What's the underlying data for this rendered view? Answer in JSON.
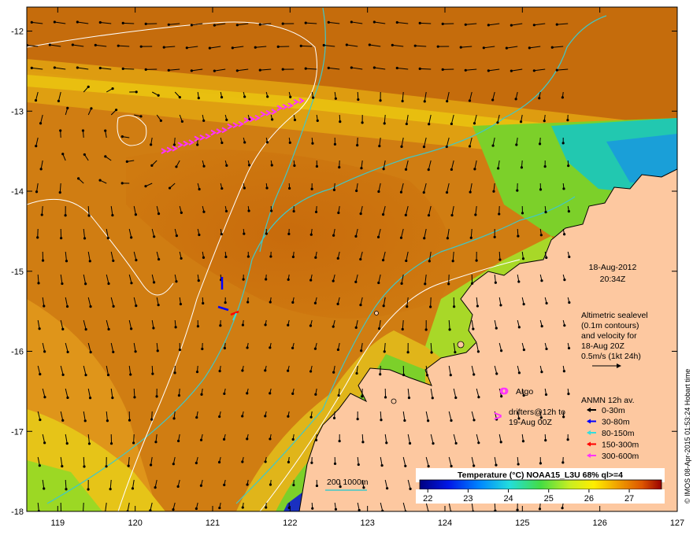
{
  "map": {
    "date_line1": "18-Aug-2012",
    "date_line2": "20:34Z",
    "altimetry_lines": [
      "Altimetric sealevel",
      "(0.1m contours)",
      "and velocity for",
      "18-Aug 20Z",
      "0.5m/s (1kt 24h)"
    ],
    "argo_label": "Argo",
    "drifters_line1": "drifters@12h to",
    "drifters_line2": "19-Aug 00Z",
    "anmn_title": "ANMN 12h av.",
    "anmn_legend": [
      {
        "label": "0-30m",
        "color": "#000000"
      },
      {
        "label": "30-80m",
        "color": "#0000ff"
      },
      {
        "label": "80-150m",
        "color": "#33dddd"
      },
      {
        "label": "150-300m",
        "color": "#ff0000"
      },
      {
        "label": "300-600m",
        "color": "#ff33ff"
      }
    ],
    "bathymetry_label": "200  1000m",
    "credit": "© IMOS 08-Apr-2015 01:53:24 Hobart time"
  },
  "colorbar": {
    "title": "Temperature (°C) NOAA15_L3U 68% ql>=4",
    "ticks": [
      "22",
      "23",
      "24",
      "25",
      "26",
      "27"
    ],
    "range": [
      21.8,
      27.8
    ]
  },
  "axes": {
    "x_ticks": [
      "119",
      "120",
      "121",
      "122",
      "123",
      "124",
      "125",
      "126",
      "127"
    ],
    "y_ticks": [
      "-12",
      "-13",
      "-14",
      "-15",
      "-16",
      "-17",
      "-18"
    ],
    "x_range": [
      118.6,
      127
    ],
    "y_range": [
      -18,
      -11.7
    ]
  },
  "colors": {
    "land": "#fdc8a0",
    "warm_water": "#d2780f",
    "cool_water": "#1a9fd8",
    "bathymetry_contour": "#40c8c8",
    "sealevel_contour": "#ffffff",
    "drifter_marker": "#ff33ff"
  }
}
